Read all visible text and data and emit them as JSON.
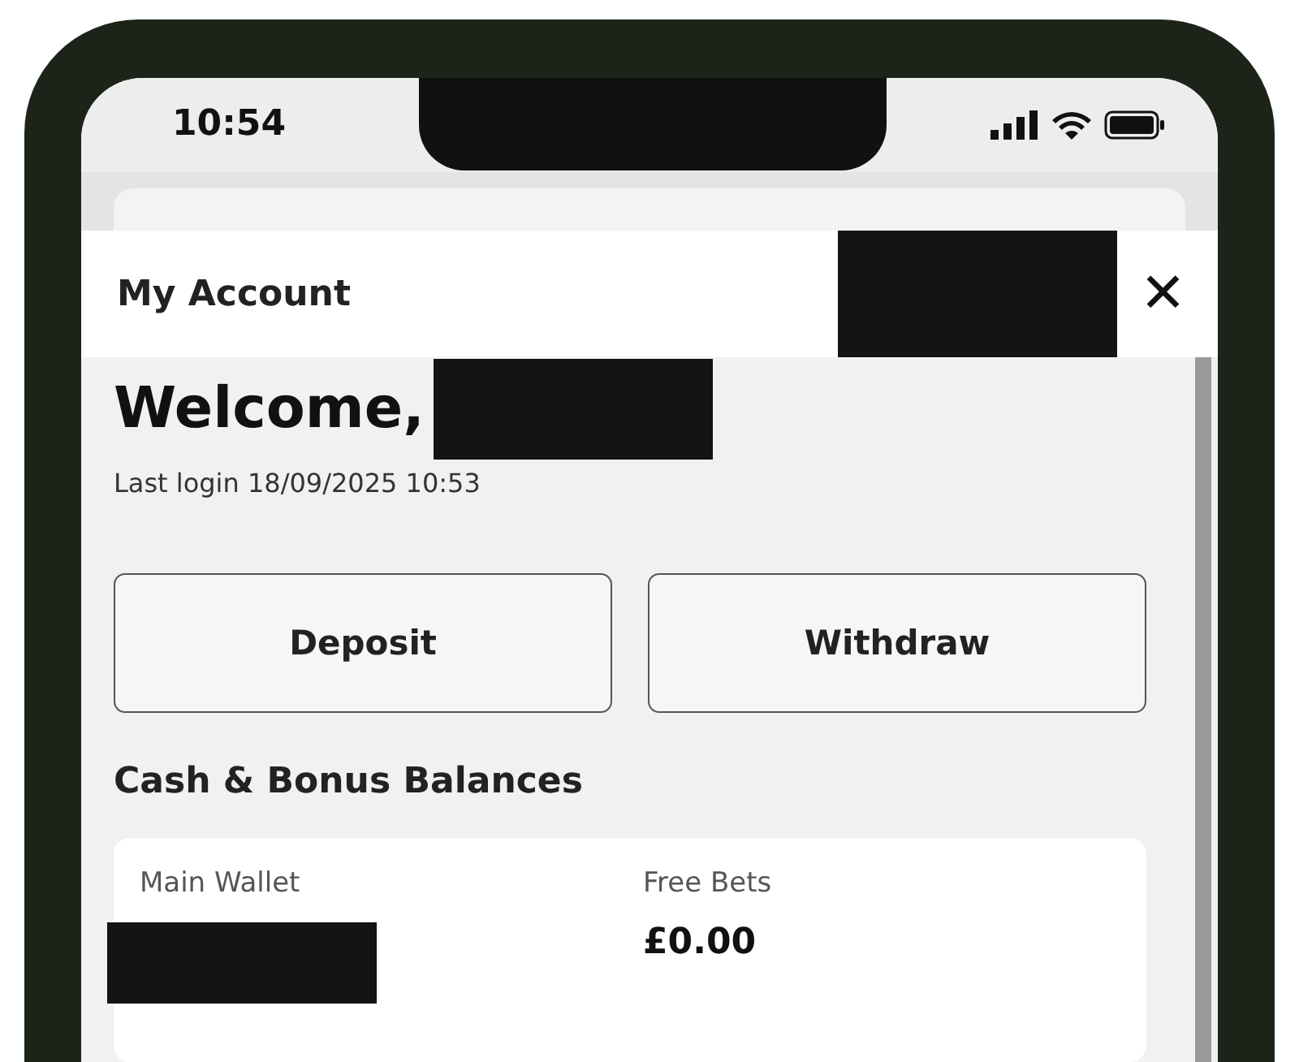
{
  "status_bar": {
    "time": "10:54"
  },
  "header": {
    "title": "My Account",
    "redacted": true,
    "close_label": "✕"
  },
  "welcome": {
    "greeting": "Welcome,",
    "name_redacted": true,
    "last_login": "Last login 18/09/2025 10:53"
  },
  "buttons": [
    "Deposit",
    "Withdraw"
  ],
  "balances": {
    "title": "Cash & Bonus Balances",
    "items": [
      {
        "label": "Main Wallet",
        "redacted": true
      },
      {
        "label": "Free Bets",
        "value": "£0.00",
        "redacted": false
      }
    ]
  }
}
